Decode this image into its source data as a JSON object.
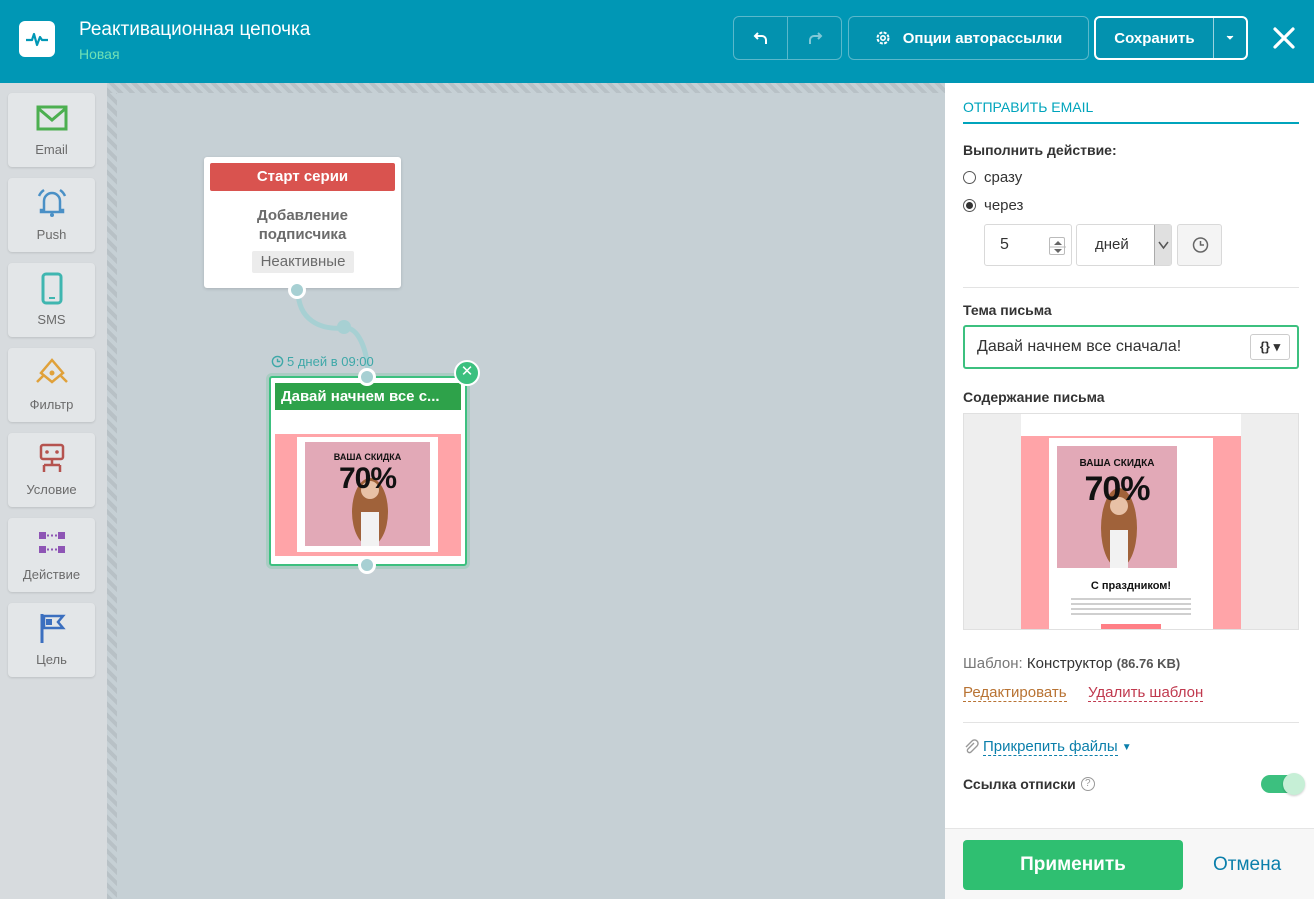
{
  "header": {
    "title": "Реактивационная цепочка",
    "status": "Новая",
    "options_label": "Опции авторассылки",
    "save_label": "Сохранить",
    "icons": [
      "pulse-logo-icon",
      "undo-icon",
      "redo-icon",
      "gear-icon",
      "chevron-down-icon",
      "close-icon"
    ]
  },
  "toolbox": {
    "items": [
      {
        "label": "Email",
        "icon": "envelope-icon",
        "color": "#4caf50"
      },
      {
        "label": "Push",
        "icon": "bell-icon",
        "color": "#4a90c6"
      },
      {
        "label": "SMS",
        "icon": "phone-icon",
        "color": "#3fb6b0"
      },
      {
        "label": "Фильтр",
        "icon": "filter-icon",
        "color": "#e0a13a"
      },
      {
        "label": "Условие",
        "icon": "condition-icon",
        "color": "#b5534f"
      },
      {
        "label": "Действие",
        "icon": "action-icon",
        "color": "#8e55b5"
      },
      {
        "label": "Цель",
        "icon": "flag-icon",
        "color": "#3b6fbf"
      }
    ]
  },
  "canvas": {
    "start_node": {
      "header": "Старт серии",
      "description": "Добавление подписчика",
      "tag": "Неактивные"
    },
    "delay_label": "5 дней в 09:00",
    "email_node": {
      "title": "Давай начнем все с...",
      "promo_line1": "ВАША СКИДКА",
      "promo_line2": "70%"
    }
  },
  "panel": {
    "section_title": "ОТПРАВИТЬ EMAIL",
    "action_label": "Выполнить действие:",
    "option_now": "сразу",
    "option_delay": "через",
    "delay_value": "5",
    "delay_unit": "дней",
    "subject_label": "Тема письма",
    "subject_value": "Давай начнем все сначала!",
    "var_button": "{}",
    "content_label": "Содержание письма",
    "preview": {
      "promo_line1": "ВАША СКИДКА",
      "promo_line2": "70%",
      "greeting": "С праздником!"
    },
    "template_label": "Шаблон:",
    "template_name": "Конструктор",
    "template_size": "(86.76 KB)",
    "edit_link": "Редактировать",
    "delete_link": "Удалить шаблон",
    "attach_label": "Прикрепить файлы",
    "unsubscribe_label": "Ссылка отписки",
    "unsubscribe_enabled": true,
    "apply_label": "Применить",
    "cancel_label": "Отмена"
  },
  "colors": {
    "header_bg": "#0097b5",
    "accent_green": "#2fbf71",
    "start_red": "#d9534f",
    "link_blue": "#0b7fab"
  }
}
